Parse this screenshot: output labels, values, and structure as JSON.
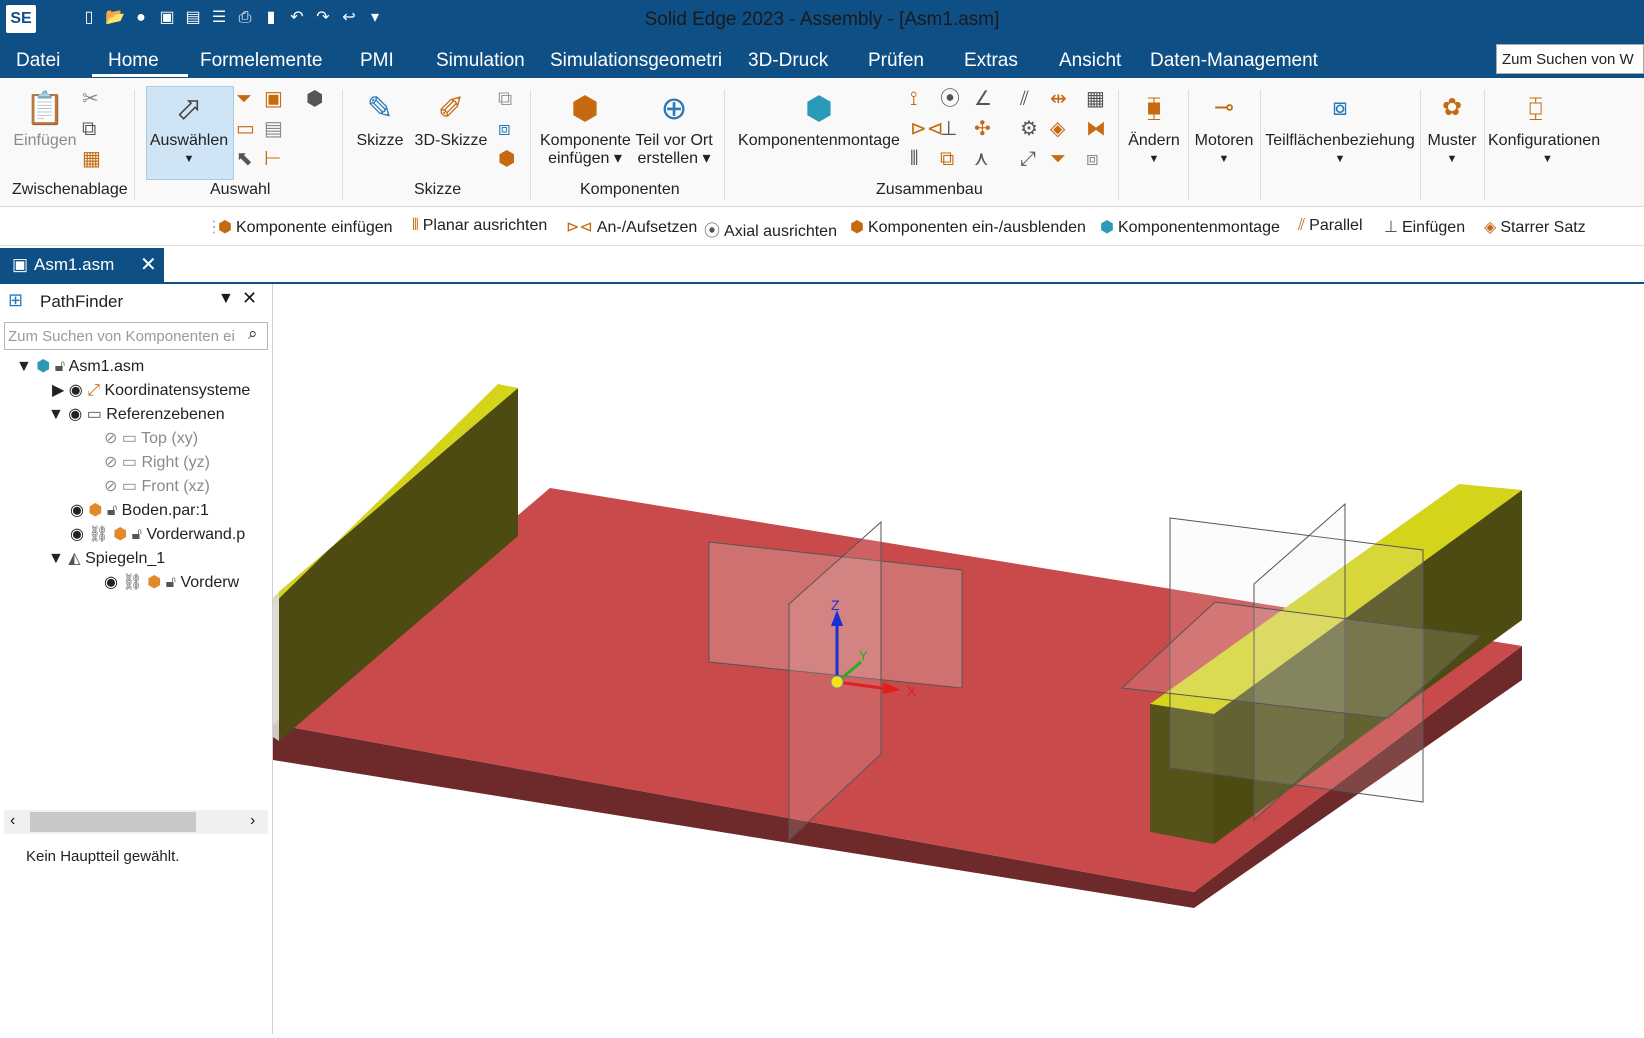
{
  "titlebar": {
    "logo": "SE",
    "title": "Solid Edge 2023 - Assembly - [Asm1.asm]",
    "quick_access": [
      "new-icon",
      "open-icon",
      "info-icon",
      "save-icon",
      "save-all-icon",
      "properties-icon",
      "print-icon",
      "clipboard-icon",
      "undo-icon",
      "redo-icon",
      "back-icon",
      "dropdown-icon"
    ]
  },
  "menu": {
    "items": [
      "Datei",
      "Home",
      "Formelemente",
      "PMI",
      "Simulation",
      "Simulationsgeometrie",
      "3D-Druck",
      "Prüfen",
      "Extras",
      "Ansicht",
      "Daten-Management"
    ],
    "active": "Home",
    "search_placeholder": "Zum Suchen von W"
  },
  "ribbon": {
    "clipboard": {
      "paste": "Einfügen",
      "group": "Zwischenablage"
    },
    "select": {
      "select": "Auswählen",
      "group": "Auswahl"
    },
    "sketch": {
      "sketch": "Skizze",
      "sketch3d": "3D-Skizze",
      "group": "Skizze"
    },
    "components": {
      "insert_line1": "Komponente",
      "insert_line2": "einfügen",
      "create_line1": "Teil vor Ort",
      "create_line2": "erstellen",
      "group": "Komponenten"
    },
    "assembly": {
      "assemble": "Komponentenmontage",
      "group": "Zusammenbau"
    },
    "tools": [
      "Ändern",
      "Motoren",
      "Teilflächenbeziehung",
      "Muster",
      "Konfigurationen"
    ]
  },
  "commandbar": {
    "items": [
      "Komponente einfügen",
      "Planar ausrichten",
      "An-/Aufsetzen",
      "Axial ausrichten",
      "Komponenten ein-/ausblenden",
      "Komponentenmontage",
      "Parallel",
      "Einfügen",
      "Starrer Satz"
    ]
  },
  "document_tab": {
    "label": "Asm1.asm",
    "close": "✕"
  },
  "pathfinder": {
    "title": "PathFinder",
    "search_placeholder": "Zum Suchen von Komponenten ei",
    "tree": {
      "root": "Asm1.asm",
      "coords": "Koordinatensysteme",
      "refplanes": "Referenzebenen",
      "top": "Top (xy)",
      "right": "Right (yz)",
      "front": "Front (xz)",
      "boden": "Boden.par:1",
      "vorderwand": "Vorderwand.p",
      "mirror": "Spiegeln_1",
      "vorderw2": "Vorderw"
    },
    "status": "Kein Hauptteil gewählt."
  },
  "viewport": {
    "axis_x": "X",
    "axis_y": "Y",
    "axis_z": "Z",
    "colors": {
      "floor_top": "#c94a4a",
      "floor_side": "#6e2a2a",
      "wall_top": "#d4d41a",
      "wall_side": "#4d4a12"
    }
  }
}
